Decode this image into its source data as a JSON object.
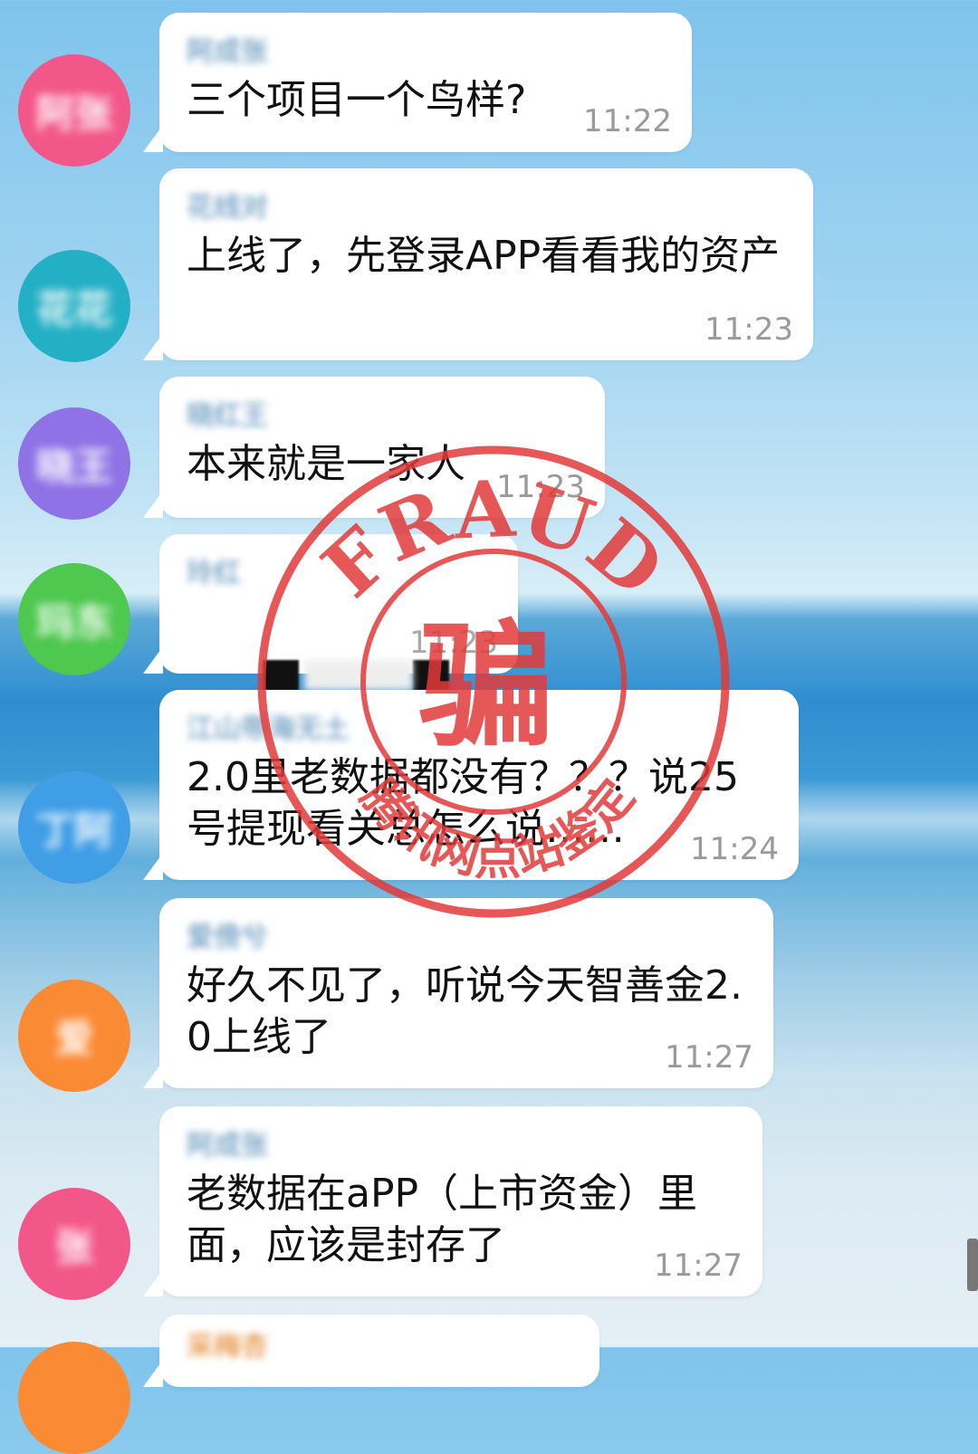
{
  "messages": [
    {
      "avatar_text": "阿张",
      "avatar_color": "#f2578a",
      "sender": "阿成张",
      "text": "三个项目一个鸟样?",
      "time": "11:22"
    },
    {
      "avatar_text": "花花",
      "avatar_color": "#23afc4",
      "sender": "花线对",
      "text": "上线了，先登录APP看看我的资产",
      "time": "11:23"
    },
    {
      "avatar_text": "晓王",
      "avatar_color": "#8e72e6",
      "sender": "晓红王",
      "text": "本来就是一家人",
      "time": "11:23"
    },
    {
      "avatar_text": "玛东",
      "avatar_color": "#4ec84f",
      "sender": "玲红",
      "text": "",
      "time": "11:23"
    },
    {
      "avatar_text": "丁阿",
      "avatar_color": "#3f9ee6",
      "sender": "江山带海无土",
      "text": "2.0里老数据都没有？？？说25号提现看关总怎么说……",
      "time": "11:24"
    },
    {
      "avatar_text": "爱",
      "avatar_color": "#fb8a35",
      "sender": "爱傍兮",
      "text": "好久不见了，听说今天智善金2.0上线了",
      "time": "11:27"
    },
    {
      "avatar_text": "张",
      "avatar_color": "#f2578a",
      "sender": "阿成张",
      "text": "老数据在aPP（上市资金）里面，应该是封存了",
      "time": "11:27"
    },
    {
      "avatar_text": "",
      "avatar_color": "#fb8a35",
      "sender": "采梅杏",
      "text": "",
      "time": ""
    }
  ],
  "stamp": {
    "top_text": "FRAUD",
    "center_char": "骗",
    "bottom_text": "腾讯网点站鉴定",
    "color": "#e23a3a"
  }
}
